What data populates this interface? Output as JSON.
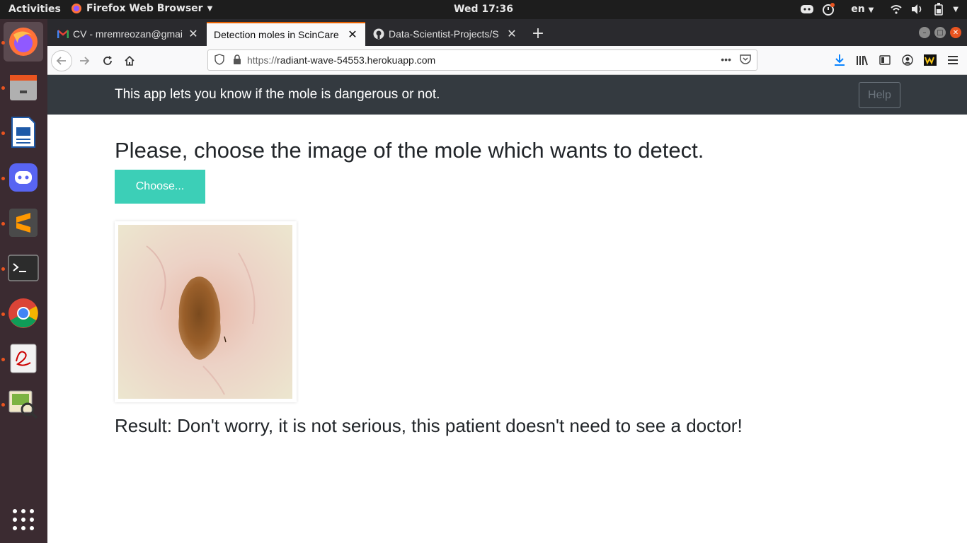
{
  "topbar": {
    "activities": "Activities",
    "app_name": "Firefox Web Browser",
    "clock": "Wed 17:36",
    "language": "en"
  },
  "dock": {
    "items": [
      "firefox",
      "files",
      "libreoffice-impress",
      "discord",
      "sublime-text",
      "terminal",
      "chrome",
      "document-viewer",
      "image-viewer"
    ]
  },
  "browser": {
    "tabs": [
      {
        "label": "CV - mremreozan@gmail",
        "favicon": "gmail-icon"
      },
      {
        "label": "Detection moles in ScinCare",
        "favicon": ""
      },
      {
        "label": "Data-Scientist-Projects/S",
        "favicon": "github-icon"
      }
    ],
    "url_scheme": "https://",
    "url_host": "radiant-wave-54553.herokuapp.com"
  },
  "page": {
    "tagline": "This app lets you know if the mole is dangerous or not.",
    "help_label": "Help",
    "heading": "Please, choose the image of the mole which wants to detect.",
    "choose_label": "Choose...",
    "result": "Result: Don't worry, it is not serious, this patient doesn't need to see a doctor!"
  },
  "colors": {
    "header_bg": "#343a40",
    "accent_button": "#3ccfb7",
    "active_tab_border": "#e66000"
  }
}
